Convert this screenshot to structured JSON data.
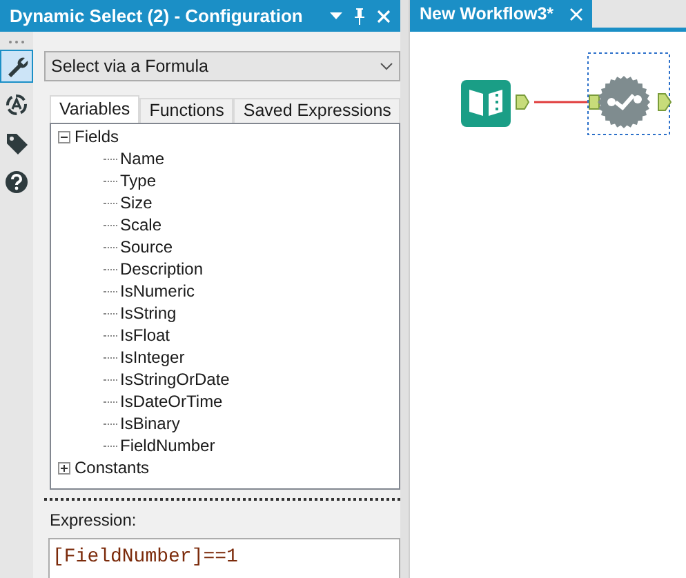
{
  "panel": {
    "title": "Dynamic Select (2) - Configuration",
    "mode_select": {
      "value": "Select via a Formula"
    },
    "side_tools": [
      {
        "kind": "wrench",
        "selected": true
      },
      {
        "kind": "target",
        "selected": false
      },
      {
        "kind": "tag",
        "selected": false
      },
      {
        "kind": "help",
        "selected": false
      }
    ],
    "tabs": [
      {
        "label": "Variables",
        "selected": true
      },
      {
        "label": "Functions",
        "selected": false
      },
      {
        "label": "Saved Expressions",
        "selected": false
      }
    ],
    "tree": [
      {
        "label": "Fields",
        "expanded": true,
        "children": [
          {
            "label": "Name"
          },
          {
            "label": "Type"
          },
          {
            "label": "Size"
          },
          {
            "label": "Scale"
          },
          {
            "label": "Source"
          },
          {
            "label": "Description"
          },
          {
            "label": "IsNumeric"
          },
          {
            "label": "IsString"
          },
          {
            "label": "IsFloat"
          },
          {
            "label": "IsInteger"
          },
          {
            "label": "IsStringOrDate"
          },
          {
            "label": "IsDateOrTime"
          },
          {
            "label": "IsBinary"
          },
          {
            "label": "FieldNumber"
          }
        ]
      },
      {
        "label": "Constants",
        "expanded": false
      }
    ],
    "expression_label": "Expression:",
    "expression": "[FieldNumber]==1"
  },
  "workflow": {
    "tabs": [
      {
        "label": "New Workflow3*",
        "selected": true
      }
    ],
    "nodes": [
      {
        "kind": "input",
        "selected": false
      },
      {
        "kind": "select",
        "selected": true
      }
    ]
  }
}
